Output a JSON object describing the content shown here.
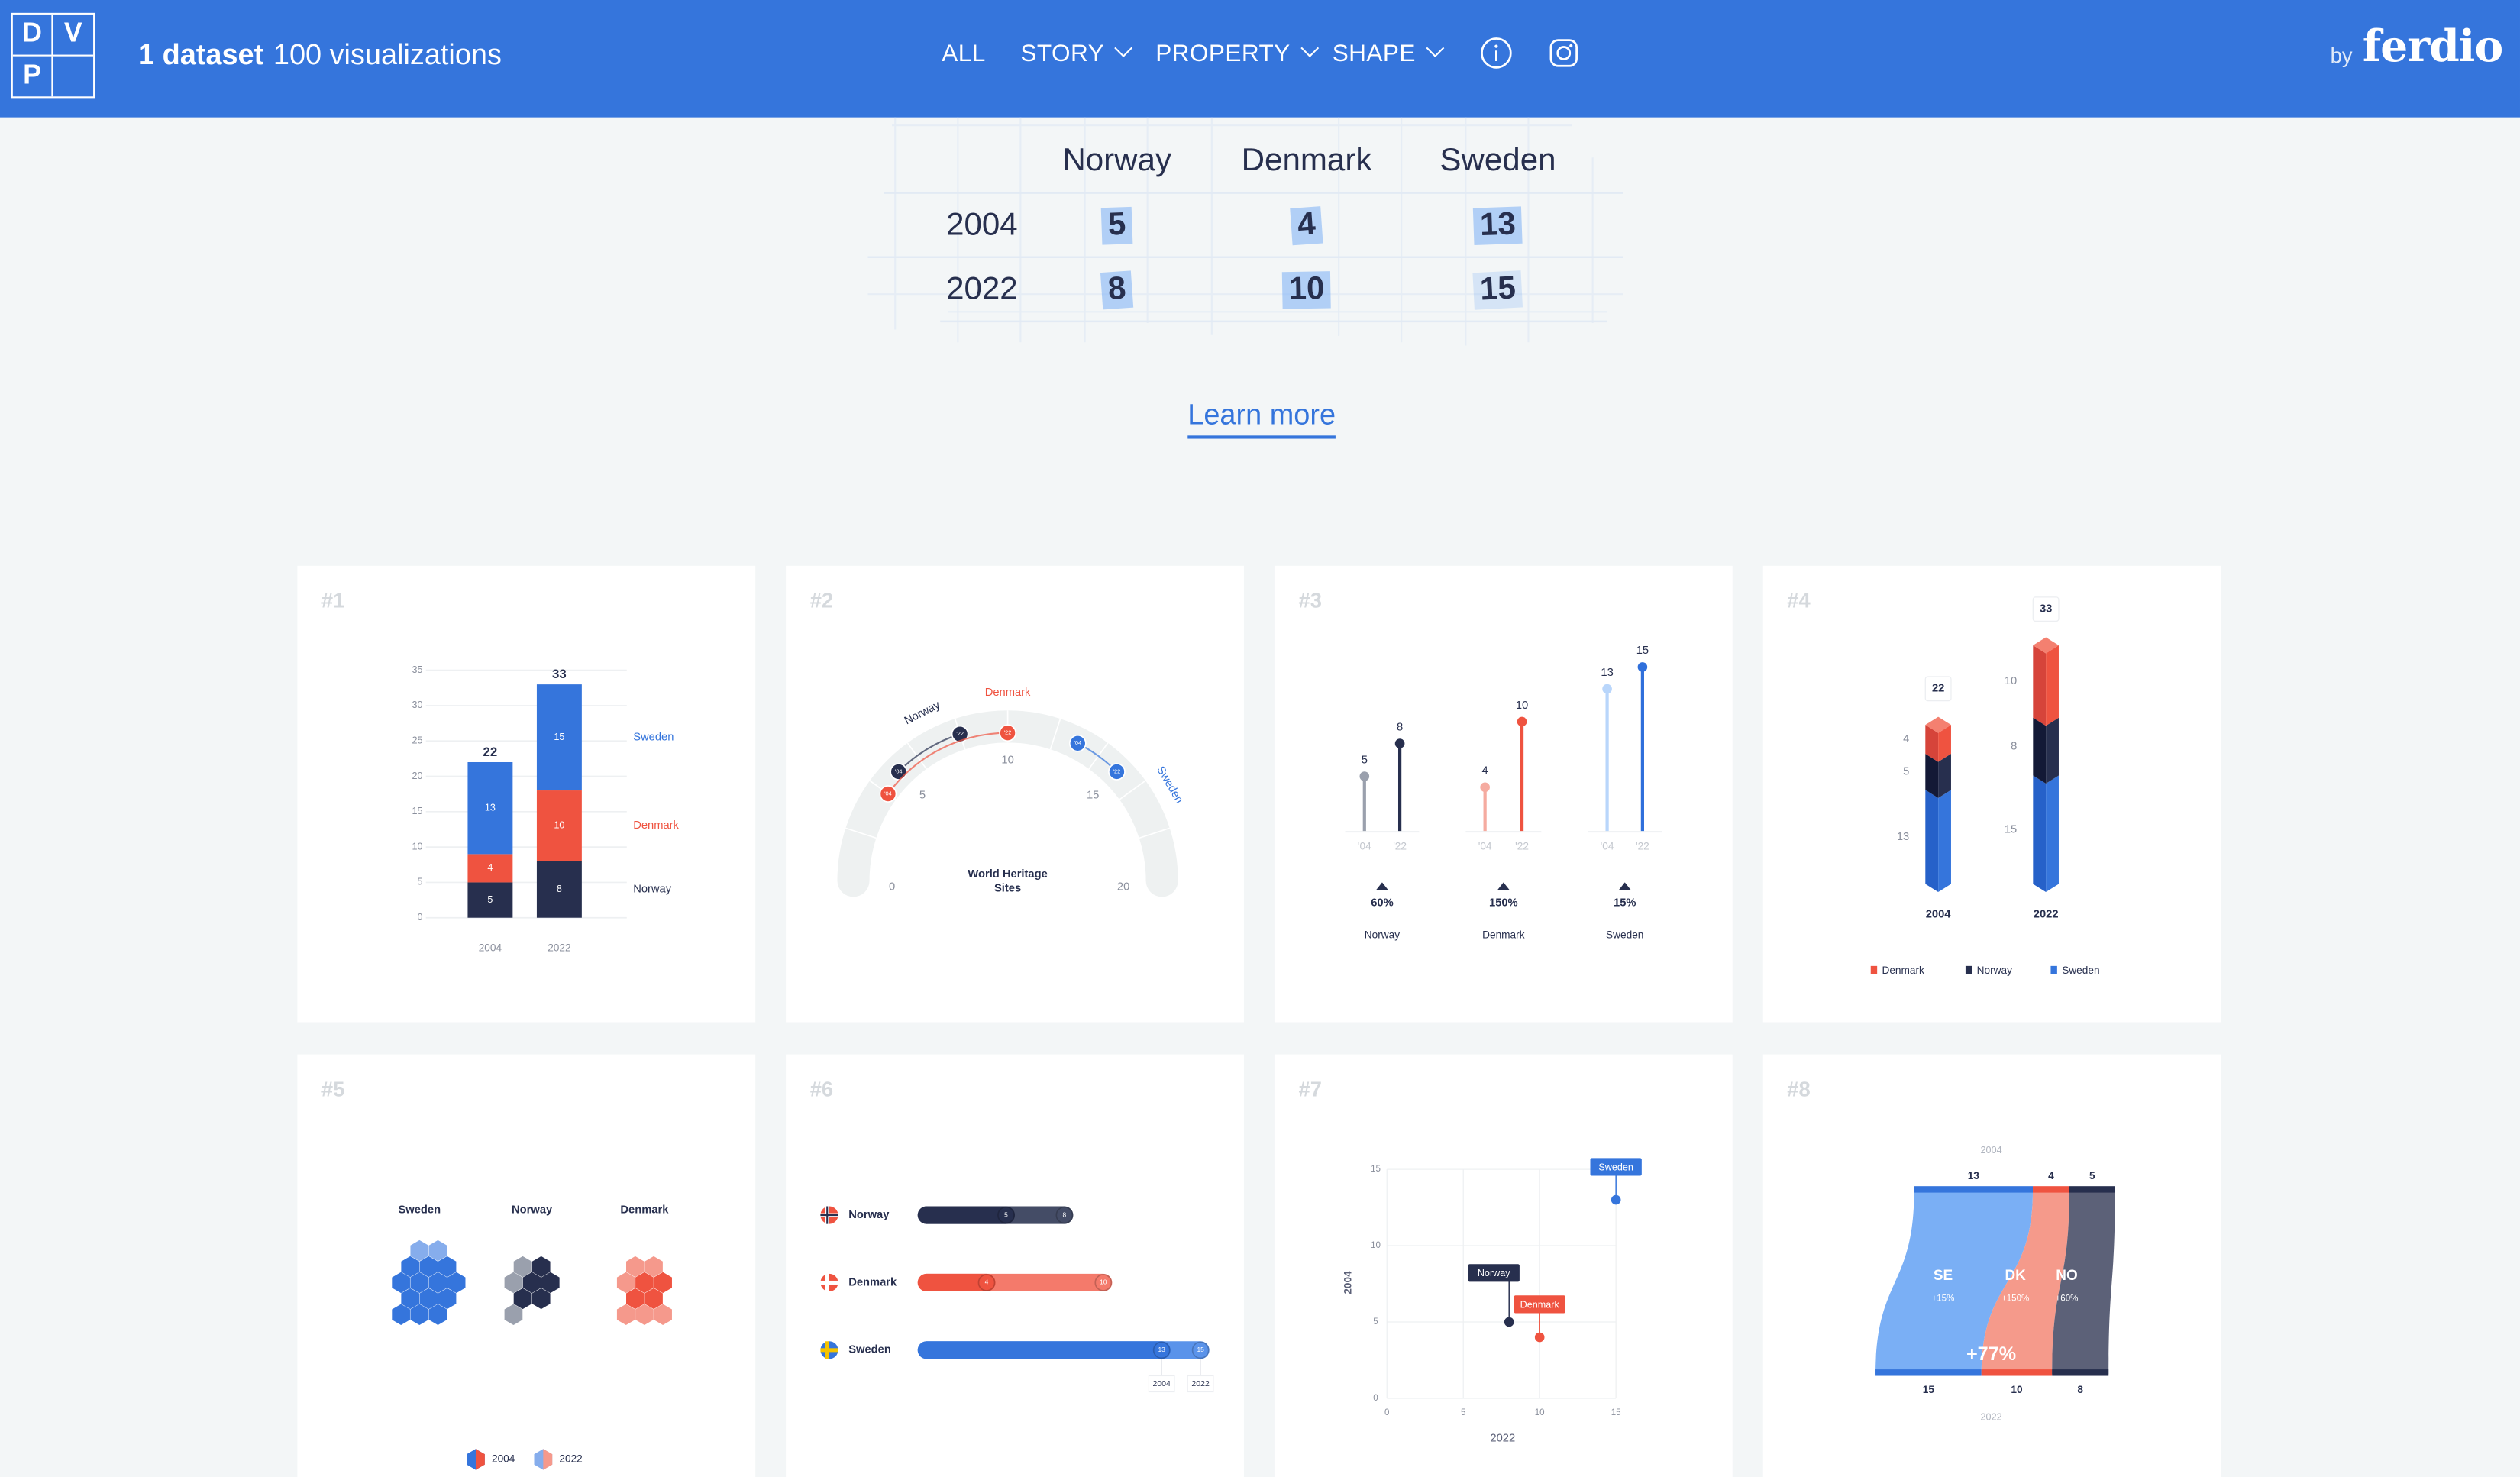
{
  "header": {
    "logo_letters": [
      "D",
      "V",
      "P"
    ],
    "title_bold": "1 dataset",
    "title_rest": "100 visualizations",
    "nav": [
      {
        "label": "ALL",
        "dropdown": false
      },
      {
        "label": "STORY",
        "dropdown": true
      },
      {
        "label": "PROPERTY",
        "dropdown": true
      },
      {
        "label": "SHAPE",
        "dropdown": true
      }
    ],
    "icons": [
      "info-icon",
      "instagram-icon"
    ],
    "by": "by",
    "brand": "ferdio"
  },
  "table": {
    "columns": [
      "Norway",
      "Denmark",
      "Sweden"
    ],
    "rows": [
      {
        "label": "2004",
        "values": [
          "5",
          "4",
          "13"
        ]
      },
      {
        "label": "2022",
        "values": [
          "8",
          "10",
          "15"
        ]
      }
    ]
  },
  "learn_more": "Learn more",
  "colors": {
    "brand": "#3575dc",
    "norway": "#272f4e",
    "denmark": "#ef5340",
    "sweden": "#3575dc",
    "background": "#f3f6f7"
  },
  "cards": [
    "#1",
    "#2",
    "#3",
    "#4",
    "#5",
    "#6",
    "#7",
    "#8"
  ],
  "chart_data": [
    {
      "type": "bar",
      "stacked": true,
      "categories": [
        "2004",
        "2022"
      ],
      "ylim": [
        0,
        35
      ],
      "yticks": [
        "0",
        "5",
        "10",
        "15",
        "20",
        "25",
        "30",
        "35"
      ],
      "grid": true,
      "series": [
        {
          "name": "Norway",
          "values": [
            5,
            8
          ],
          "color": "#272f4e"
        },
        {
          "name": "Denmark",
          "values": [
            4,
            10
          ],
          "color": "#ef5340"
        },
        {
          "name": "Sweden",
          "values": [
            13,
            15
          ],
          "color": "#3575dc"
        }
      ],
      "totals": [
        "22",
        "33"
      ],
      "legend": "right"
    },
    {
      "type": "gauge",
      "label_lines": [
        "World Heritage",
        "Sites"
      ],
      "range": [
        0,
        20
      ],
      "ticks": [
        "0",
        "5",
        "10",
        "15",
        "20"
      ],
      "series": [
        {
          "name": "Norway",
          "values": [
            5,
            8
          ],
          "color": "#272f4e"
        },
        {
          "name": "Denmark",
          "values": [
            4,
            10
          ],
          "color": "#ef5340"
        },
        {
          "name": "Sweden",
          "values": [
            13,
            15
          ],
          "color": "#3575dc"
        }
      ],
      "point_labels": [
        "'04",
        "'22"
      ]
    },
    {
      "type": "lollipop",
      "year_labels": [
        "'04",
        "'22"
      ],
      "groups": [
        {
          "name": "Norway",
          "values": [
            5,
            8
          ],
          "value_labels": [
            "5",
            "8"
          ],
          "change": "60%",
          "colors": [
            "#9aa0ad",
            "#272f4e"
          ]
        },
        {
          "name": "Denmark",
          "values": [
            4,
            10
          ],
          "value_labels": [
            "4",
            "10"
          ],
          "change": "150%",
          "colors": [
            "#f5aba0",
            "#ef5340"
          ]
        },
        {
          "name": "Sweden",
          "values": [
            13,
            15
          ],
          "value_labels": [
            "13",
            "15"
          ],
          "change": "15%",
          "colors": [
            "#b9d6fb",
            "#2f6fdb"
          ]
        }
      ]
    },
    {
      "type": "bar",
      "stacked": true,
      "style": "3d",
      "categories": [
        "2004",
        "2022"
      ],
      "totals": [
        "22",
        "33"
      ],
      "series": [
        {
          "name": "Denmark",
          "values": [
            4,
            10
          ],
          "labels": [
            "4",
            "10"
          ],
          "color": "#ef5340"
        },
        {
          "name": "Norway",
          "values": [
            5,
            8
          ],
          "labels": [
            "5",
            "8"
          ],
          "color": "#272f4e"
        },
        {
          "name": "Sweden",
          "values": [
            13,
            15
          ],
          "labels": [
            "13",
            "15"
          ],
          "color": "#3575dc"
        }
      ],
      "legend": "bottom"
    },
    {
      "type": "pictogram",
      "shape": "hexagon",
      "categories": [
        "Sweden",
        "Norway",
        "Denmark"
      ],
      "values_2004": [
        13,
        5,
        4
      ],
      "values_2022": [
        15,
        8,
        10
      ],
      "colors": [
        [
          "#3575dc",
          "#86adec"
        ],
        [
          "#272f4e",
          "#9aa0ad"
        ],
        [
          "#ef5340",
          "#f5998c"
        ]
      ],
      "legend": [
        "2004",
        "2022"
      ]
    },
    {
      "type": "bar",
      "orientation": "horizontal",
      "categories": [
        "Norway",
        "Denmark",
        "Sweden"
      ],
      "series": [
        {
          "name": "2004",
          "values": [
            5,
            4,
            13
          ],
          "labels": [
            "5",
            "4",
            "13"
          ]
        },
        {
          "name": "2022",
          "values": [
            8,
            10,
            15
          ],
          "labels": [
            "8",
            "10",
            "15"
          ]
        }
      ],
      "colors": [
        [
          "#272f4e",
          "#444c66"
        ],
        [
          "#ef5340",
          "#f47a6b"
        ],
        [
          "#3575dc",
          "#5a93ea"
        ]
      ],
      "legend": [
        "2004",
        "2022"
      ]
    },
    {
      "type": "scatter",
      "xlabel": "2022",
      "ylabel": "2004",
      "xlim": [
        0,
        15
      ],
      "ylim": [
        0,
        15
      ],
      "xticks": [
        "0",
        "5",
        "10",
        "15"
      ],
      "yticks": [
        "0",
        "5",
        "10",
        "15"
      ],
      "grid": true,
      "points": [
        {
          "name": "Norway",
          "x": 8,
          "y": 5,
          "color": "#272f4e"
        },
        {
          "name": "Denmark",
          "x": 10,
          "y": 4,
          "color": "#ef5340"
        },
        {
          "name": "Sweden",
          "x": 15,
          "y": 13,
          "color": "#3575dc"
        }
      ]
    },
    {
      "type": "flow",
      "top_label": "2004",
      "bottom_label": "2022",
      "total_change": "+77%",
      "nodes": [
        {
          "code": "SE",
          "change": "+15%",
          "from": 13,
          "to": 15,
          "from_label": "13",
          "to_label": "15",
          "colors": [
            "#3575dc",
            "#7aaff5"
          ]
        },
        {
          "code": "DK",
          "change": "+150%",
          "from": 4,
          "to": 10,
          "from_label": "4",
          "to_label": "10",
          "colors": [
            "#ef5340",
            "#f59a8b"
          ]
        },
        {
          "code": "NO",
          "change": "+60%",
          "from": 5,
          "to": 8,
          "from_label": "5",
          "to_label": "8",
          "colors": [
            "#272f4e",
            "#5c6178"
          ]
        }
      ]
    }
  ]
}
